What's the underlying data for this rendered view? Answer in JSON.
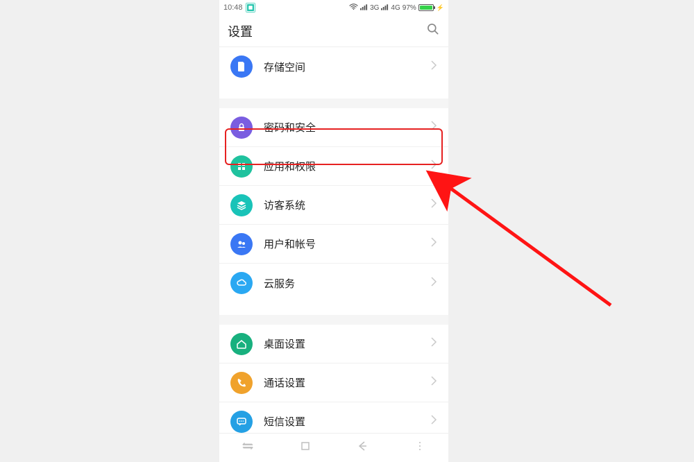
{
  "statusbar": {
    "time": "10:48",
    "signal_3g": "3G",
    "signal_4g": "4G",
    "battery_percent": "97%"
  },
  "header": {
    "title": "设置"
  },
  "groups": [
    {
      "rows": [
        {
          "id": "storage",
          "label": "存储空间",
          "color": "#3a77f4",
          "icon": "sd-icon"
        }
      ]
    },
    {
      "rows": [
        {
          "id": "security",
          "label": "密码和安全",
          "color": "#7a5de0",
          "icon": "lock-icon"
        },
        {
          "id": "apps-permissions",
          "label": "应用和权限",
          "color": "#1fc29e",
          "icon": "grid-icon",
          "highlighted": true
        },
        {
          "id": "guest",
          "label": "访客系统",
          "color": "#19c3b8",
          "icon": "stack-icon"
        },
        {
          "id": "accounts",
          "label": "用户和帐号",
          "color": "#3a77f4",
          "icon": "users-icon"
        },
        {
          "id": "cloud",
          "label": "云服务",
          "color": "#2aa8f2",
          "icon": "cloud-icon"
        }
      ]
    },
    {
      "rows": [
        {
          "id": "desktop",
          "label": "桌面设置",
          "color": "#18b07e",
          "icon": "home-icon"
        },
        {
          "id": "call",
          "label": "通话设置",
          "color": "#f0a22c",
          "icon": "phone-icon"
        },
        {
          "id": "sms",
          "label": "短信设置",
          "color": "#24a0e4",
          "icon": "message-icon"
        }
      ]
    }
  ],
  "annotation": {
    "highlight_target": "apps-permissions"
  }
}
